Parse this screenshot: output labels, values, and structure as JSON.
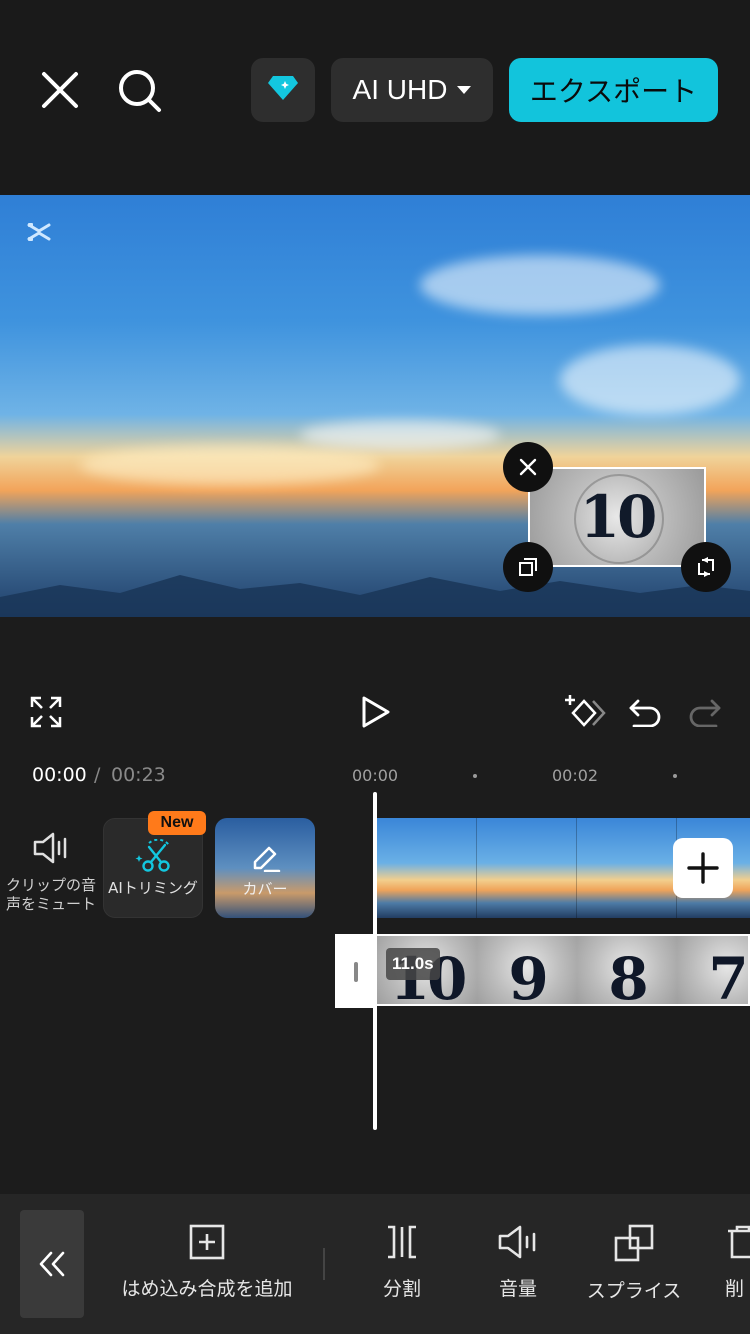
{
  "topbar": {
    "resolution_label": "AI UHD",
    "export_label": "エクスポート"
  },
  "overlay_clip": {
    "number_label": "10"
  },
  "timeline": {
    "current_time": "00:00",
    "separator": "/",
    "total_time": "00:23",
    "ticks": [
      "00:00",
      "00:02"
    ]
  },
  "tools": {
    "mute_label": "クリップの音声をミュート",
    "ai_trim_label": "AIトリミング",
    "new_badge": "New",
    "cover_label": "カバー"
  },
  "overlay_track": {
    "duration": "11.0s",
    "frames": [
      "10",
      "9",
      "8",
      "7"
    ]
  },
  "bottom_toolbar": {
    "items": [
      {
        "label": "はめ込み合成を追加"
      },
      {
        "label": "分割"
      },
      {
        "label": "音量"
      },
      {
        "label": "スプライス"
      },
      {
        "label": "削"
      }
    ]
  },
  "colors": {
    "accent": "#12c4dc",
    "badge": "#ff7a1a",
    "background": "#1c1c1c"
  }
}
